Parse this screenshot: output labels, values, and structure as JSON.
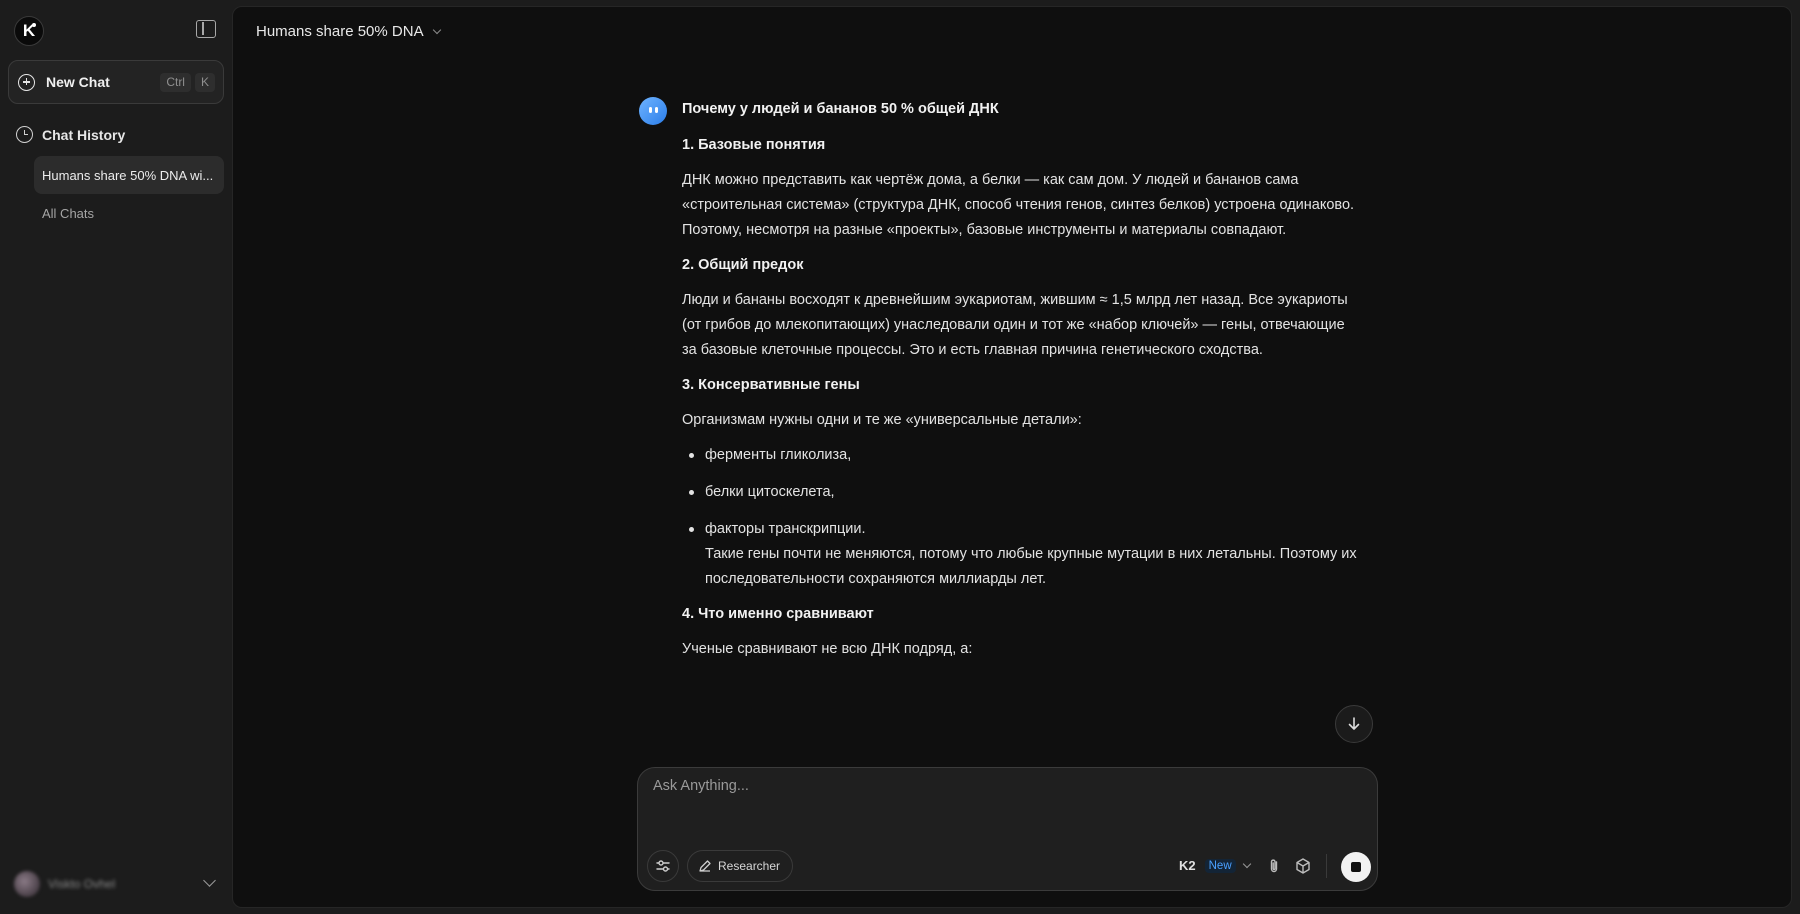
{
  "sidebar": {
    "logo_letter": "K",
    "new_chat": {
      "label": "New Chat",
      "shortcut": [
        "Ctrl",
        "K"
      ]
    },
    "history": {
      "title": "Chat History",
      "items": [
        {
          "label": "Humans share 50% DNA wi..."
        }
      ],
      "all_chats": "All Chats"
    },
    "user": {
      "name": "Viskto Ovhel"
    }
  },
  "header": {
    "title": "Humans share 50% DNA"
  },
  "message": {
    "title": "Почему у людей и бананов 50 % общей ДНК",
    "s1": {
      "heading": "1. Базовые понятия",
      "text": "ДНК можно представить как чертёж дома, а белки — как сам дом. У людей и бананов сама «строительная система» (структура ДНК, способ чтения генов, синтез белков) устроена одинаково. Поэтому, несмотря на разные «проекты», базовые инструменты и материалы совпадают."
    },
    "s2": {
      "heading": "2. Общий предок",
      "text": "Люди и бананы восходят к древнейшим эукариотам, жившим ≈ 1,5 млрд лет назад. Все эукариоты (от грибов до млекопитающих) унаследовали один и тот же «набор ключей» — гены, отвечающие за базовые клеточные процессы. Это и есть главная причина генетического сходства."
    },
    "s3": {
      "heading": "3. Консервативные гены",
      "intro": "Организмам нужны одни и те же «универсальные детали»:",
      "items": [
        "ферменты гликолиза,",
        "белки цитоскелета,",
        "факторы транскрипции."
      ],
      "note": "Такие гены почти не меняются, потому что любые крупные мутации в них летальны. Поэтому их последовательности сохраняются миллиарды лет."
    },
    "s4": {
      "heading": "4. Что именно сравнивают",
      "text": "Ученые сравнивают не всю ДНК подряд, а:"
    }
  },
  "composer": {
    "placeholder": "Ask Anything...",
    "researcher_label": "Researcher",
    "model": "K2",
    "model_badge": "New"
  },
  "colors": {
    "accent": "#4aa0ff",
    "background": "#0f0f0f",
    "sidebar": "#1c1c1c"
  }
}
